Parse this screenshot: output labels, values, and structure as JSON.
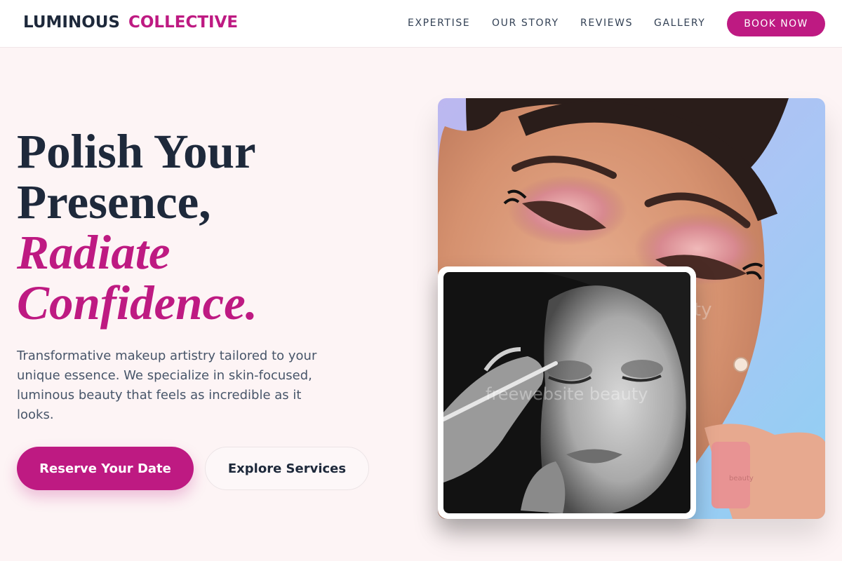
{
  "brand": {
    "part1": "LUMINOUS",
    "part2": "COLLECTIVE"
  },
  "nav": {
    "items": [
      "EXPERTISE",
      "OUR STORY",
      "REVIEWS",
      "GALLERY"
    ],
    "cta": "BOOK NOW"
  },
  "hero": {
    "line1": "Polish Your",
    "line2": "Presence,",
    "accent1": "Radiate",
    "accent2": "Confidence.",
    "description": "Transformative makeup artistry tailored to your unique essence. We specialize in skin-focused, luminous beauty that feels as incredible as it looks.",
    "primary_cta": "Reserve Your Date",
    "secondary_cta": "Explore Services"
  },
  "images": {
    "main": {
      "subject": "close-up of woman with pink glitter eyeshadow holding lipstick",
      "watermark": "beauty"
    },
    "inset": {
      "subject": "black and white photo of makeup artist applying eyeliner",
      "watermark": "freewebsite beauty"
    }
  },
  "colors": {
    "accent": "#be1a82",
    "text": "#1e293b",
    "background": "#fdf4f5"
  }
}
